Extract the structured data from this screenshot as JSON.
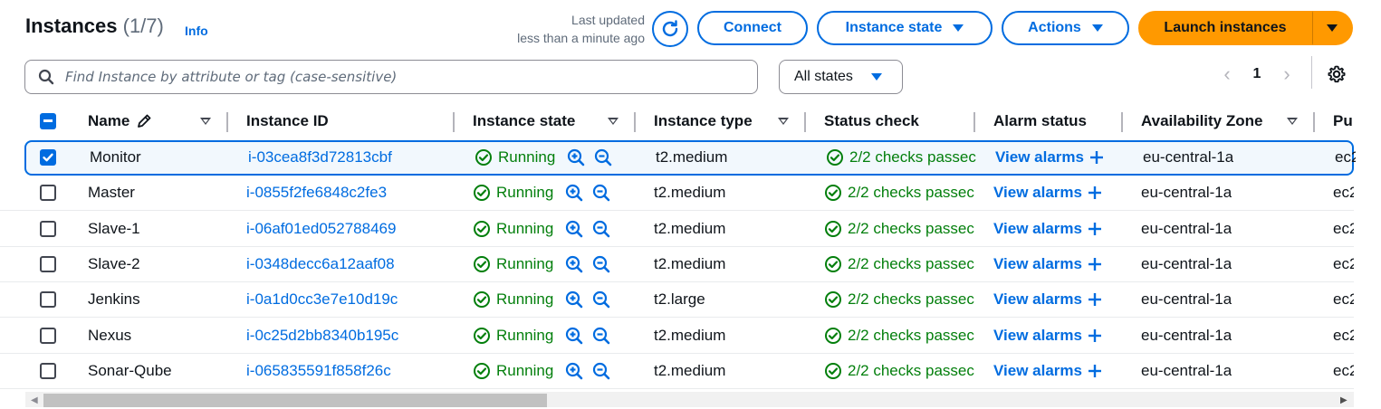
{
  "header": {
    "title": "Instances",
    "count": "(1/7)",
    "info": "Info",
    "last_updated_line1": "Last updated",
    "last_updated_line2": "less than a minute ago"
  },
  "buttons": {
    "connect": "Connect",
    "instance_state": "Instance state",
    "actions": "Actions",
    "launch": "Launch instances"
  },
  "filter": {
    "search_placeholder": "Find Instance by attribute or tag (case-sensitive)",
    "states_value": "All states"
  },
  "pagination": {
    "current_page": "1"
  },
  "columns": {
    "name": "Name",
    "instance_id": "Instance ID",
    "instance_state": "Instance state",
    "instance_type": "Instance type",
    "status_check": "Status check",
    "alarm_status": "Alarm status",
    "availability_zone": "Availability Zone",
    "public_dns": "Pu"
  },
  "rows": [
    {
      "name": "Monitor",
      "id": "i-03cea8f3d72813cbf",
      "state": "Running",
      "type": "t2.medium",
      "status": "2/2 checks passec",
      "alarm": "View alarms",
      "az": "eu-central-1a",
      "dns": "ec2",
      "selected": true
    },
    {
      "name": "Master",
      "id": "i-0855f2fe6848c2fe3",
      "state": "Running",
      "type": "t2.medium",
      "status": "2/2 checks passec",
      "alarm": "View alarms",
      "az": "eu-central-1a",
      "dns": "ec2",
      "selected": false
    },
    {
      "name": "Slave-1",
      "id": "i-06af01ed052788469",
      "state": "Running",
      "type": "t2.medium",
      "status": "2/2 checks passec",
      "alarm": "View alarms",
      "az": "eu-central-1a",
      "dns": "ec2",
      "selected": false
    },
    {
      "name": "Slave-2",
      "id": "i-0348decc6a12aaf08",
      "state": "Running",
      "type": "t2.medium",
      "status": "2/2 checks passec",
      "alarm": "View alarms",
      "az": "eu-central-1a",
      "dns": "ec2",
      "selected": false
    },
    {
      "name": "Jenkins",
      "id": "i-0a1d0cc3e7e10d19c",
      "state": "Running",
      "type": "t2.large",
      "status": "2/2 checks passec",
      "alarm": "View alarms",
      "az": "eu-central-1a",
      "dns": "ec2",
      "selected": false
    },
    {
      "name": "Nexus",
      "id": "i-0c25d2bb8340b195c",
      "state": "Running",
      "type": "t2.medium",
      "status": "2/2 checks passec",
      "alarm": "View alarms",
      "az": "eu-central-1a",
      "dns": "ec2",
      "selected": false
    },
    {
      "name": "Sonar-Qube",
      "id": "i-065835591f858f26c",
      "state": "Running",
      "type": "t2.medium",
      "status": "2/2 checks passec",
      "alarm": "View alarms",
      "az": "eu-central-1a",
      "dns": "ec2",
      "selected": false
    }
  ],
  "colors": {
    "accent": "#006ce0",
    "launch": "#ff9900",
    "success": "#037f0c",
    "selected_row": "#f2f8fd"
  },
  "icons": [
    "refresh-icon",
    "caret-down-icon",
    "search-icon",
    "chevron-left-icon",
    "chevron-right-icon",
    "settings-gear-icon",
    "edit-pencil-icon",
    "sort-caret-icon",
    "check-circle-icon",
    "zoom-in-icon",
    "zoom-out-icon",
    "plus-icon",
    "checkbox-icon"
  ]
}
